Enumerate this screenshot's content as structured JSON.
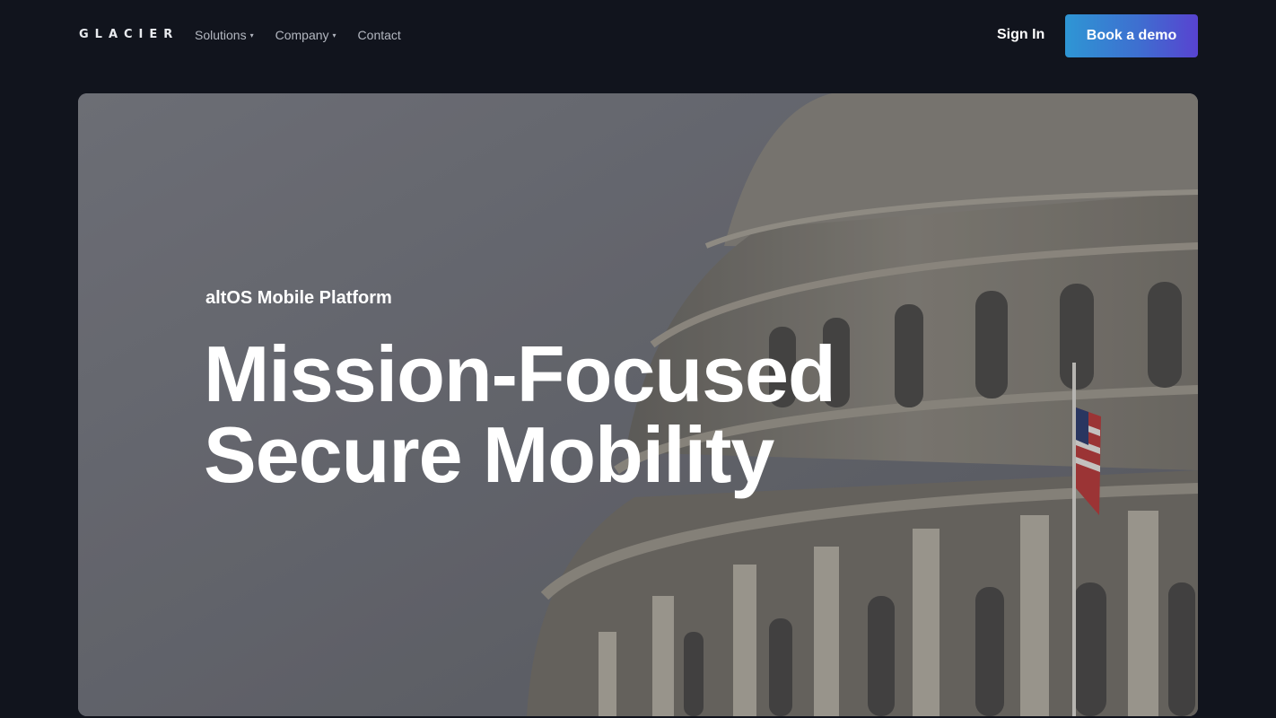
{
  "nav": {
    "logo": "GLACIER",
    "links": [
      {
        "label": "Solutions",
        "has_dropdown": true
      },
      {
        "label": "Company",
        "has_dropdown": true
      },
      {
        "label": "Contact",
        "has_dropdown": false
      }
    ],
    "caret_icon": "▾",
    "sign_in": "Sign In",
    "cta": "Book a demo"
  },
  "hero": {
    "eyebrow": "altOS Mobile Platform",
    "headline_line1": "Mission-Focused",
    "headline_line2": "Secure Mobility",
    "image": "capitol-dome-with-flag"
  },
  "colors": {
    "page_bg": "#11141d",
    "cta_gradient_start": "#2e96d4",
    "cta_gradient_end": "#5843d0"
  }
}
